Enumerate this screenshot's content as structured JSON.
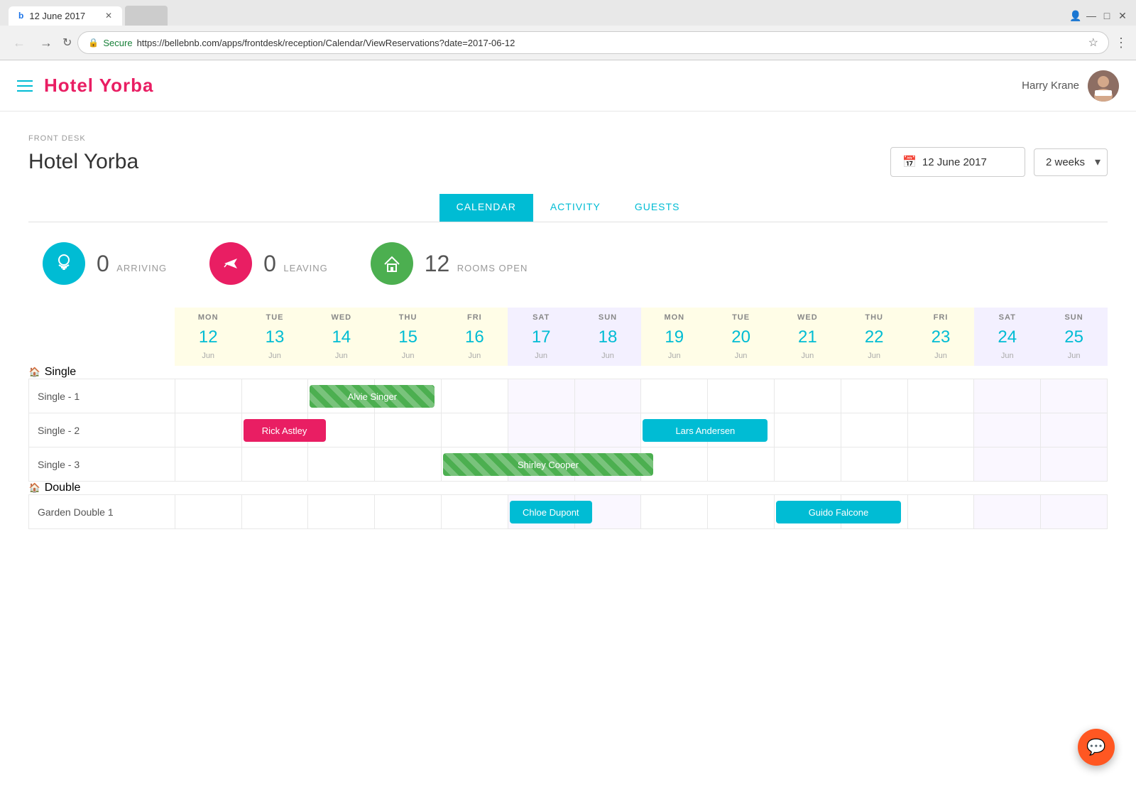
{
  "browser": {
    "tab_title": "12 June 2017",
    "tab_icon": "b",
    "url": "https://bellebnb.com/apps/frontdesk/reception/Calendar/ViewReservations?date=2017-06-12",
    "secure_text": "Secure"
  },
  "header": {
    "logo": "Hotel Yorba",
    "user_name": "Harry Krane",
    "avatar_emoji": "🧑"
  },
  "page": {
    "breadcrumb": "FRONT DESK",
    "title": "Hotel Yorba",
    "date_value": "12 June 2017",
    "weeks_value": "2 weeks"
  },
  "tabs": [
    {
      "id": "calendar",
      "label": "CALENDAR",
      "active": true
    },
    {
      "id": "activity",
      "label": "ACTIVITY",
      "active": false
    },
    {
      "id": "guests",
      "label": "GUESTS",
      "active": false
    }
  ],
  "stats": {
    "arriving": {
      "count": "0",
      "label": "ARRIVING"
    },
    "leaving": {
      "count": "0",
      "label": "LEAVING"
    },
    "open": {
      "count": "12",
      "label": "ROOMS OPEN"
    }
  },
  "calendar": {
    "days": [
      {
        "dow": "MON",
        "date": "12",
        "month": "Jun",
        "type": "weekday"
      },
      {
        "dow": "TUE",
        "date": "13",
        "month": "Jun",
        "type": "weekday"
      },
      {
        "dow": "WED",
        "date": "14",
        "month": "Jun",
        "type": "weekday"
      },
      {
        "dow": "THU",
        "date": "15",
        "month": "Jun",
        "type": "weekday"
      },
      {
        "dow": "FRI",
        "date": "16",
        "month": "Jun",
        "type": "weekday"
      },
      {
        "dow": "SAT",
        "date": "17",
        "month": "Jun",
        "type": "weekend"
      },
      {
        "dow": "SUN",
        "date": "18",
        "month": "Jun",
        "type": "weekend"
      },
      {
        "dow": "MON",
        "date": "19",
        "month": "Jun",
        "type": "weekday"
      },
      {
        "dow": "TUE",
        "date": "20",
        "month": "Jun",
        "type": "weekday"
      },
      {
        "dow": "WED",
        "date": "21",
        "month": "Jun",
        "type": "weekday"
      },
      {
        "dow": "THU",
        "date": "22",
        "month": "Jun",
        "type": "weekday"
      },
      {
        "dow": "FRI",
        "date": "23",
        "month": "Jun",
        "type": "weekday"
      },
      {
        "dow": "SAT",
        "date": "24",
        "month": "Jun",
        "type": "weekend"
      },
      {
        "dow": "SUN",
        "date": "25",
        "month": "Jun",
        "type": "weekend"
      }
    ],
    "sections": [
      {
        "name": "Single",
        "rooms": [
          {
            "name": "Single - 1",
            "reservations": [
              {
                "guest": "Alvie Singer",
                "start": 2,
                "end": 5,
                "style": "green-stripe"
              }
            ]
          },
          {
            "name": "Single - 2",
            "reservations": [
              {
                "guest": "Rick Astley",
                "start": 1,
                "end": 3,
                "style": "pink"
              },
              {
                "guest": "Lars Andersen",
                "start": 7,
                "end": 10,
                "style": "cyan"
              }
            ]
          },
          {
            "name": "Single - 3",
            "reservations": [
              {
                "guest": "Shirley Cooper",
                "start": 4,
                "end": 9,
                "style": "green-stripe"
              }
            ]
          }
        ]
      },
      {
        "name": "Double",
        "rooms": [
          {
            "name": "Garden Double 1",
            "reservations": [
              {
                "guest": "Chloe Dupont",
                "start": 5,
                "end": 7,
                "style": "cyan"
              },
              {
                "guest": "Guido Falcone",
                "start": 9,
                "end": 12,
                "style": "cyan"
              }
            ]
          }
        ]
      }
    ]
  },
  "chat_icon": "💬"
}
